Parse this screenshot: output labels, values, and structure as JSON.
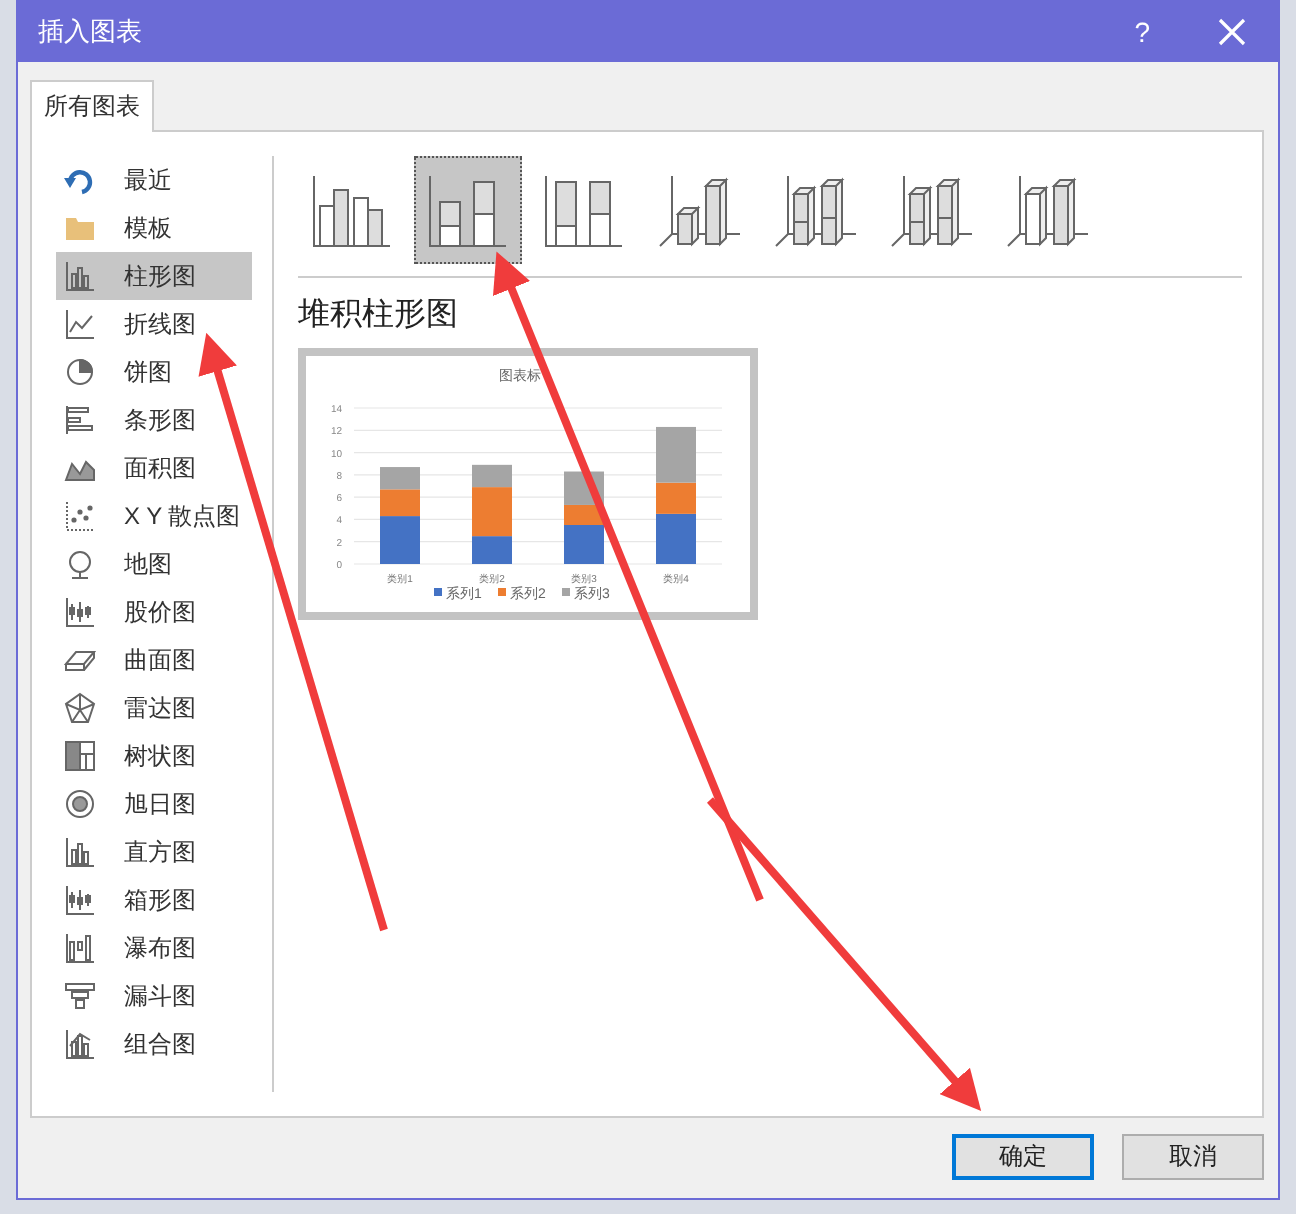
{
  "window": {
    "title": "插入图表",
    "help": "?"
  },
  "tabs": [
    {
      "label": "所有图表",
      "selected": true
    }
  ],
  "categories": [
    {
      "kind": "recent",
      "label": "最近",
      "selected": false
    },
    {
      "kind": "template",
      "label": "模板",
      "selected": false
    },
    {
      "kind": "column",
      "label": "柱形图",
      "selected": true
    },
    {
      "kind": "line",
      "label": "折线图",
      "selected": false
    },
    {
      "kind": "pie",
      "label": "饼图",
      "selected": false
    },
    {
      "kind": "bar",
      "label": "条形图",
      "selected": false
    },
    {
      "kind": "area",
      "label": "面积图",
      "selected": false
    },
    {
      "kind": "scatter",
      "label": "X Y 散点图",
      "selected": false
    },
    {
      "kind": "map",
      "label": "地图",
      "selected": false
    },
    {
      "kind": "stock",
      "label": "股价图",
      "selected": false
    },
    {
      "kind": "surface",
      "label": "曲面图",
      "selected": false
    },
    {
      "kind": "radar",
      "label": "雷达图",
      "selected": false
    },
    {
      "kind": "treemap",
      "label": "树状图",
      "selected": false
    },
    {
      "kind": "sunburst",
      "label": "旭日图",
      "selected": false
    },
    {
      "kind": "histogram",
      "label": "直方图",
      "selected": false
    },
    {
      "kind": "box",
      "label": "箱形图",
      "selected": false
    },
    {
      "kind": "waterfall",
      "label": "瀑布图",
      "selected": false
    },
    {
      "kind": "funnel",
      "label": "漏斗图",
      "selected": false
    },
    {
      "kind": "combo",
      "label": "组合图",
      "selected": false
    }
  ],
  "subtypes": [
    {
      "kind": "clustered",
      "selected": false
    },
    {
      "kind": "stacked",
      "selected": true
    },
    {
      "kind": "percent",
      "selected": false
    },
    {
      "kind": "clustered3d",
      "selected": false
    },
    {
      "kind": "stacked3d",
      "selected": false
    },
    {
      "kind": "percent3d",
      "selected": false
    },
    {
      "kind": "column3d",
      "selected": false
    }
  ],
  "subtype_title": "堆积柱形图",
  "preview": {
    "chart_data": {
      "type": "bar",
      "title": "图表标",
      "stacked": true,
      "grid": true,
      "legend": true,
      "categories": [
        "类别1",
        "类别2",
        "类别3",
        "类别4"
      ],
      "yticks": [
        0,
        2,
        4,
        6,
        8,
        10,
        12,
        14
      ],
      "ylim": [
        0,
        14
      ],
      "series": [
        {
          "name": "系列1",
          "color": "#4472c4",
          "values": [
            4.3,
            2.5,
            3.5,
            4.5
          ]
        },
        {
          "name": "系列2",
          "color": "#ed7d31",
          "values": [
            2.4,
            4.4,
            1.8,
            2.8
          ]
        },
        {
          "name": "系列3",
          "color": "#a5a5a5",
          "values": [
            2,
            2,
            3,
            5
          ]
        }
      ]
    }
  },
  "buttons": [
    {
      "label": "确定",
      "focused": true
    },
    {
      "label": "取消",
      "focused": false
    }
  ]
}
